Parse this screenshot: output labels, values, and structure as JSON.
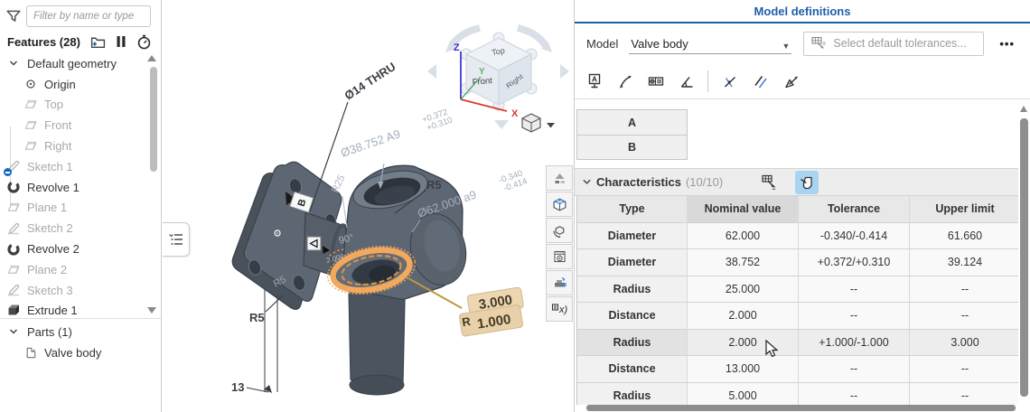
{
  "colors": {
    "accent_blue": "#1f5fa9",
    "selection_blue": "#a9d4f0",
    "highlight_orange": "#f2a95e",
    "tag_tan": "#e8d0a8"
  },
  "icons": {
    "filter": "funnel",
    "insert-folder": "folder-plus",
    "suppress": "pause-bars",
    "rollback": "stopwatch",
    "model-menu": "ellipsis",
    "view-options": "cube-with-caret"
  },
  "sidebar": {
    "filter_placeholder": "Filter by name or type",
    "features_label": "Features (28)",
    "tree": [
      {
        "label": "Default geometry",
        "muted": false
      },
      {
        "label": "Origin",
        "muted": false
      },
      {
        "label": "Top",
        "muted": true
      },
      {
        "label": "Front",
        "muted": true
      },
      {
        "label": "Right",
        "muted": true
      },
      {
        "label": "Sketch 1",
        "muted": true
      },
      {
        "label": "Revolve 1",
        "muted": false
      },
      {
        "label": "Plane 1",
        "muted": true
      },
      {
        "label": "Sketch 2",
        "muted": true
      },
      {
        "label": "Revolve 2",
        "muted": false
      },
      {
        "label": "Plane 2",
        "muted": true
      },
      {
        "label": "Sketch 3",
        "muted": true
      },
      {
        "label": "Extrude 1",
        "muted": false
      }
    ],
    "parts_label": "Parts (1)",
    "parts": [
      {
        "label": "Valve body"
      }
    ]
  },
  "viewport": {
    "view_cube": {
      "top": "Top",
      "front": "Front",
      "right": "Right"
    },
    "axes": {
      "x": "X",
      "y": "Y",
      "z": "Z"
    },
    "dims": {
      "hole": "Ø14 THRU",
      "d38": "Ø38.752 A9",
      "d38_up": "+0.372",
      "d38_lo": "+0.310",
      "r25": "R25",
      "r5_top": "R5",
      "d62": "Ø62.000 a9",
      "d62_up": "-0.340",
      "d62_lo": "-0.414",
      "angle": "90°",
      "d2": "2.000",
      "r5_small": "R5",
      "r5_bottom": "R5",
      "len13": "13"
    },
    "datum_b": "B",
    "tag": {
      "prefix": "R",
      "upper": "3.000",
      "lower": "1.000"
    }
  },
  "right_panel": {
    "title": "Model definitions",
    "model_label": "Model",
    "model_value": "Valve body",
    "tolerances_placeholder": "Select default tolerances...",
    "menu": "•••",
    "datums": [
      "A",
      "B"
    ],
    "characteristics": {
      "title": "Characteristics",
      "count": "(10/10)"
    },
    "table": {
      "headers": [
        "Type",
        "Nominal value",
        "Tolerance",
        "Upper limit"
      ],
      "rows": [
        {
          "type": "Diameter",
          "nominal": "62.000",
          "tol": "-0.340/-0.414",
          "upper": "61.660"
        },
        {
          "type": "Diameter",
          "nominal": "38.752",
          "tol": "+0.372/+0.310",
          "upper": "39.124"
        },
        {
          "type": "Radius",
          "nominal": "25.000",
          "tol": "--",
          "upper": "--"
        },
        {
          "type": "Distance",
          "nominal": "2.000",
          "tol": "--",
          "upper": "--"
        },
        {
          "type": "Radius",
          "nominal": "2.000",
          "tol": "+1.000/-1.000",
          "upper": "3.000"
        },
        {
          "type": "Distance",
          "nominal": "13.000",
          "tol": "--",
          "upper": "--"
        },
        {
          "type": "Radius",
          "nominal": "5.000",
          "tol": "--",
          "upper": "--"
        }
      ]
    }
  }
}
